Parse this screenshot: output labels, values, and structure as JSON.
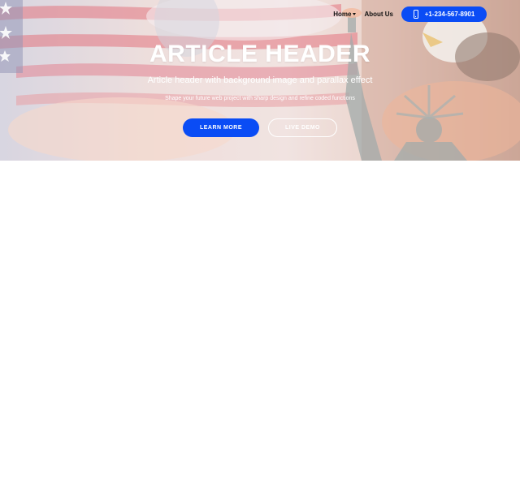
{
  "nav": {
    "home_label": "Home",
    "about_label": "About Us",
    "phone_label": "+1-234-567-8901"
  },
  "hero": {
    "title": "ARTICLE HEADER",
    "subtitle": "Article header with background image and parallax effect",
    "tagline": "Shape your future web project with sharp design and refine coded functions",
    "primary_button": "LEARN MORE",
    "secondary_button": "LIVE DEMO"
  },
  "colors": {
    "accent": "#0a4cf5",
    "hero_text": "#ffffff",
    "nav_text": "#111111",
    "page_background": "#ffffff"
  },
  "icons": {
    "phone": "phone-icon",
    "dropdown": "caret-down-icon"
  }
}
